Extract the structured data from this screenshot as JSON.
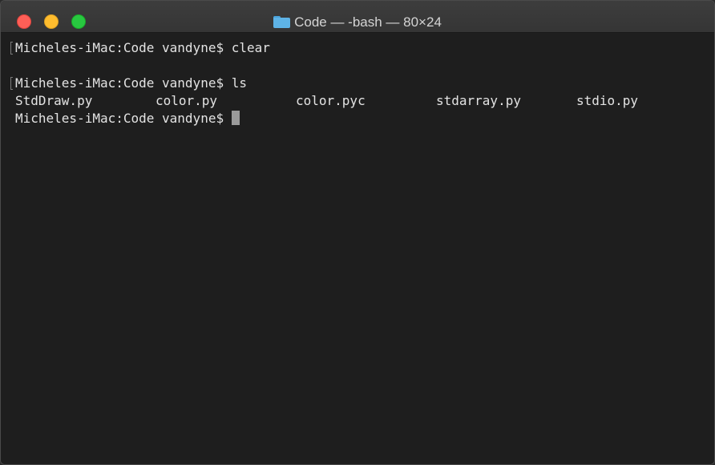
{
  "window": {
    "title": "Code — -bash — 80×24",
    "controls": [
      "close",
      "minimize",
      "zoom"
    ]
  },
  "terminal": {
    "lines": [
      {
        "prompt": "Micheles-iMac:Code vandyne$",
        "command": "clear"
      },
      {
        "prompt": "Micheles-iMac:Code vandyne$",
        "command": "ls"
      }
    ],
    "ls_output": [
      "StdDraw.py",
      "color.py",
      "color.pyc",
      "stdarray.py",
      "stdio.py"
    ],
    "current_prompt": "Micheles-iMac:Code vandyne$"
  },
  "icons": {
    "title_icon": "folder-icon"
  },
  "colors": {
    "background": "#1e1e1e",
    "text": "#e3e3e3",
    "close": "#fe5f57",
    "minimize": "#febc2e",
    "zoom": "#28c840",
    "folder": "#5eb3e6"
  }
}
